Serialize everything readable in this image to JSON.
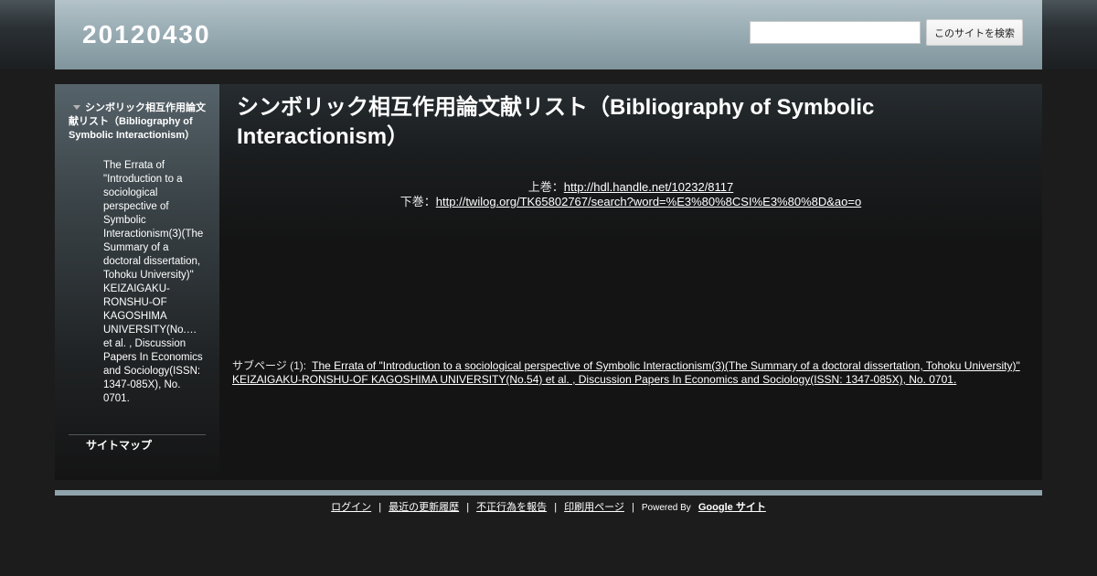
{
  "header": {
    "site_title": "20120430",
    "search_placeholder": "",
    "search_button": "このサイトを検索"
  },
  "sidebar": {
    "parent_item": "シンボリック相互作用論文献リスト（Bibliography of Symbolic Interactionism）",
    "child_item": "The Errata of \"Introduction to a sociological perspective of Symbolic Interactionism(3)(The Summary of a doctoral dissertation, Tohoku University)\" KEIZAIGAKU-RONSHU-OF KAGOSHIMA UNIVERSITY(No.… et al. , Discussion Papers In Economics and Sociology(ISSN: 1347-085X), No. 0701.",
    "sitemap": "サイトマップ"
  },
  "main": {
    "title": "シンボリック相互作用論文献リスト（Bibliography of Symbolic Interactionism）",
    "volume1_label": "上巻：",
    "volume1_link": "http://hdl.handle.net/10232/8117",
    "volume2_label": "下巻：",
    "volume2_link": "http://twilog.org/TK65802767/search?word=%E3%80%8CSI%E3%80%8D&ao=o",
    "subpages_label": "サブページ (1):",
    "subpage_link": "The Errata of \"Introduction to a sociological perspective of Symbolic Interactionism(3)(The Summary of a doctoral dissertation, Tohoku University)\" KEIZAIGAKU-RONSHU-OF KAGOSHIMA UNIVERSITY(No.54) et al. , Discussion Papers In Economics and Sociology(ISSN: 1347-085X), No. 0701."
  },
  "footer": {
    "login": "ログイン",
    "recent": "最近の更新履歴",
    "report": "不正行為を報告",
    "print": "印刷用ページ",
    "powered_by": "Powered By",
    "google_sites": "Google サイト",
    "separator": "|"
  }
}
